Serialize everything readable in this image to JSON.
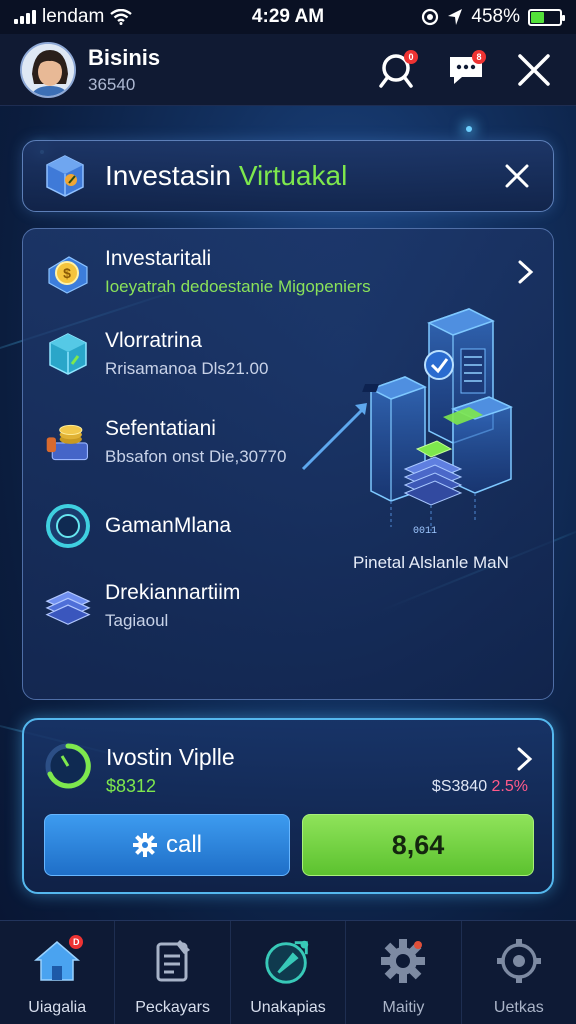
{
  "status_bar": {
    "carrier": "lendam",
    "time": "4:29 AM",
    "battery_percent": "45",
    "battery_text": "458%"
  },
  "header": {
    "user_name": "Bisinis",
    "user_id": "36540",
    "search_icon": "search-icon",
    "chat_icon": "chat-icon",
    "close_icon": "close-icon",
    "search_badge": "0",
    "chat_badge": "8"
  },
  "title_panel": {
    "title_part1": "Investasin ",
    "title_part2": "Virtuakal",
    "icon": "box-icon"
  },
  "list": {
    "items": [
      {
        "title": "Investaritali",
        "subtitle": "Ioeyatrah dedoestanie Migopeniers",
        "icon": "coin-icon"
      },
      {
        "title": "Vlorratrina",
        "subtitle": "Rrisamanoa Dls21.00",
        "icon": "cube-icon"
      },
      {
        "title": "Sefentatiani",
        "subtitle": "Bbsafon onst Die,30770",
        "icon": "coins-stack-icon"
      },
      {
        "title": "GamanMlana",
        "subtitle": "",
        "icon": "ring-icon"
      },
      {
        "title": "Drekiannartiim",
        "subtitle": "Tagiaoul",
        "icon": "layers-icon"
      }
    ],
    "illustration_caption": "Pinetal Alslanle MaN",
    "illustration_small": "0011"
  },
  "invest_panel": {
    "title": "Ivostin Viplle",
    "value": "$8312",
    "stat_amount": "$S3840 ",
    "stat_percent": "2.5%",
    "call_label": "call",
    "amount_label": "8,64"
  },
  "bottom_nav": [
    {
      "label": "Uiagalia",
      "icon": "home-icon",
      "badge": "D"
    },
    {
      "label": "Peckayars",
      "icon": "document-icon",
      "badge": ""
    },
    {
      "label": "Unakapias",
      "icon": "rocket-icon",
      "badge": ""
    },
    {
      "label": "Maitiy",
      "icon": "gear-icon",
      "badge": ""
    },
    {
      "label": "Uetkas",
      "icon": "settings-icon",
      "badge": ""
    }
  ],
  "colors": {
    "accent_green": "#7ee84d",
    "accent_blue": "#55b8ee",
    "background": "#12305f"
  }
}
